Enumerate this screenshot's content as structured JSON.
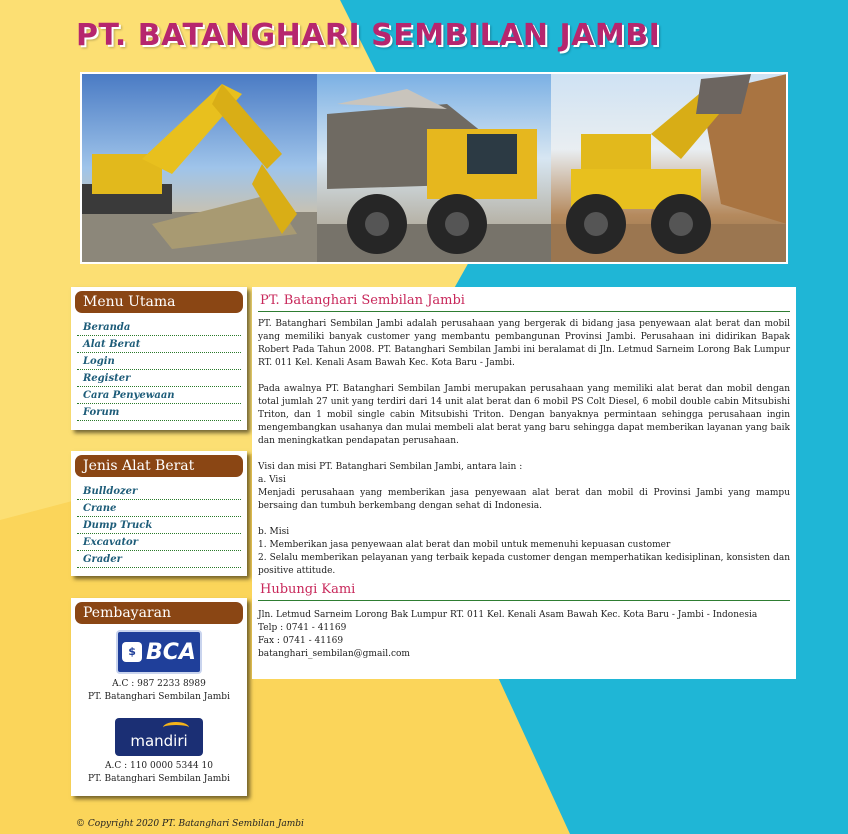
{
  "site": {
    "title": "PT. BATANGHARI SEMBILAN JAMBI"
  },
  "menu_utama": {
    "heading": "Menu Utama",
    "items": [
      "Beranda",
      "Alat Berat",
      "Login",
      "Register",
      "Cara Penyewaan",
      "Forum"
    ]
  },
  "jenis_alat": {
    "heading": "Jenis Alat Berat",
    "items": [
      "Bulldozer",
      "Crane",
      "Dump Truck",
      "Excavator",
      "Grader"
    ]
  },
  "pembayaran": {
    "heading": "Pembayaran",
    "banks": [
      {
        "logo": "BCA",
        "account": "A.C : 987 2233 8989",
        "holder": "PT. Batanghari Sembilan Jambi"
      },
      {
        "logo": "mandiri",
        "account": "A.C : 110 0000 5344 10",
        "holder": "PT. Batanghari Sembilan Jambi"
      }
    ]
  },
  "main": {
    "title": "PT. Batanghari Sembilan Jambi",
    "p1": "PT. Batanghari Sembilan Jambi adalah perusahaan yang bergerak di bidang jasa penyewaan alat berat dan mobil yang memiliki banyak customer yang membantu pembangunan Provinsi Jambi. Perusahaan ini didirikan Bapak Robert Pada Tahun 2008. PT. Batanghari Sembilan Jambi ini beralamat di Jln. Letmud Sarneim Lorong Bak Lumpur RT. 011 Kel. Kenali Asam Bawah Kec. Kota Baru - Jambi.",
    "p2": "Pada awalnya PT. Batanghari Sembilan Jambi merupakan perusahaan yang memiliki alat berat dan mobil dengan total jumlah 27 unit yang terdiri dari 14 unit alat berat dan 6 mobil PS Colt Diesel, 6 mobil double cabin Mitsubishi Triton, dan 1 mobil single cabin Mitsubishi Triton. Dengan banyaknya permintaan sehingga perusahaan ingin mengembangkan usahanya dan mulai membeli alat berat yang baru sehingga dapat memberikan layanan yang baik dan meningkatkan pendapatan perusahaan.",
    "visi_misi_intro": "Visi dan misi PT. Batanghari Sembilan Jambi, antara lain :",
    "visi_label": "a. Visi",
    "visi_text": "Menjadi perusahaan yang memberikan jasa penyewaan alat berat dan mobil di Provinsi Jambi yang mampu bersaing dan tumbuh berkembang dengan sehat di Indonesia.",
    "misi_label": "b. Misi",
    "misi_1": "1. Memberikan jasa penyewaan alat berat dan mobil untuk memenuhi kepuasan customer",
    "misi_2": "2. Selalu memberikan pelayanan yang terbaik kepada customer dengan memperhatikan kedisiplinan, konsisten dan positive attitude.",
    "contact_title": "Hubungi Kami",
    "address": "Jln. Letmud Sarneim Lorong Bak Lumpur RT. 011 Kel. Kenali Asam Bawah Kec. Kota Baru - Jambi - Indonesia",
    "telp": "Telp : 0741 - 41169",
    "fax": "Fax : 0741 - 41169",
    "email": "batanghari_sembilan@gmail.com"
  },
  "footer": {
    "text": "© Copyright 2020 PT. Batanghari Sembilan Jambi"
  },
  "colors": {
    "title": "#b6266e",
    "box_header": "#8a4614",
    "section_title": "#c8275a",
    "bg_yellow": "#fbd55a",
    "bg_cyan": "#1fb6d6"
  }
}
